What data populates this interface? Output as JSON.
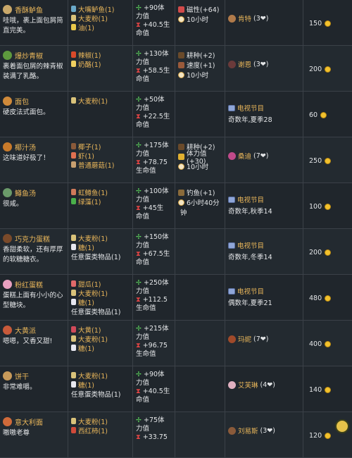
{
  "rows": [
    {
      "name": "香酥鲈鱼",
      "icon_color": "#c9a86a",
      "desc": [
        "哇哦，裹上面包屑简",
        "直完美。"
      ],
      "ingredients": [
        {
          "text": "大嘴鲈鱼(1)",
          "color": "#6aa9c9"
        },
        {
          "text": "大麦粉(1)",
          "color": "#d9c27a"
        },
        {
          "text": "油(1)",
          "color": "#e9c84a"
        }
      ],
      "energy": "+90体",
      "energy2": "力值",
      "health": "+40.5生",
      "health2": "命值",
      "buffs": [
        {
          "text": "磁性(+64)",
          "icon": "magnet-icon",
          "color": "#d24a4a"
        },
        {
          "text": "10小时",
          "icon": "clock-icon"
        }
      ],
      "npc": {
        "name": "肯特",
        "hearts": "(3❤)",
        "face": "#b07a4a"
      },
      "price": "150"
    },
    {
      "name": "爆炒青椒",
      "icon_color": "#5e9a3e",
      "desc": [
        "裹着面包屑的辣青椒",
        "装满了乳酪。"
      ],
      "ingredients": [
        {
          "text": "辣椒(1)",
          "color": "#d94a2a"
        },
        {
          "text": "奶酪(1)",
          "color": "#f0d060"
        }
      ],
      "energy": "+130体",
      "energy2": "力值",
      "health": "+58.5生",
      "health2": "命值",
      "buffs": [
        {
          "text": "耕种(+2)",
          "icon": "hoe-icon",
          "color": "#6a4a2a"
        },
        {
          "text": "速度(+1)",
          "icon": "boots-icon",
          "color": "#9a5a3a"
        },
        {
          "text": "10小时",
          "icon": "clock-icon"
        }
      ],
      "npc": {
        "name": "谢恩",
        "hearts": "(3❤)",
        "face": "#6a3a3a"
      },
      "price": "200"
    },
    {
      "name": "面包",
      "icon_color": "#d08a3a",
      "desc": [
        "硬皮法式面包。"
      ],
      "ingredients": [
        {
          "text": "大麦粉(1)",
          "color": "#d9c27a"
        }
      ],
      "energy": "+50体",
      "energy2": "力值",
      "health": "+22.5生",
      "health2": "命值",
      "buffs": [],
      "tv": {
        "title": "电视节目",
        "sub": "奇数年,夏季28"
      },
      "price": "60"
    },
    {
      "name": "椰汁汤",
      "icon_color": "#c87a2a",
      "desc": [
        "这味道好极了！"
      ],
      "ingredients": [
        {
          "text": "椰子(1)",
          "color": "#8a5a3a"
        },
        {
          "text": "虾(1)",
          "color": "#e07050"
        },
        {
          "text": "普通蘑菇(1)",
          "color": "#c8a070"
        }
      ],
      "energy": "+175体",
      "energy2": "力值",
      "health": "+78.75",
      "health2": "生命值",
      "buffs": [
        {
          "text": "耕种(+2)",
          "icon": "hoe-icon",
          "color": "#6a4a2a"
        },
        {
          "text": "体力值(+30)",
          "icon": "energy-icon",
          "color": "#e0b030"
        },
        {
          "text": "10小时",
          "icon": "clock-icon"
        }
      ],
      "npc": {
        "name": "桑迪",
        "hearts": "(7❤)",
        "face": "#c04a8a"
      },
      "price": "250"
    },
    {
      "name": "鳟鱼汤",
      "icon_color": "#6a9a6a",
      "desc": [
        "很咸。"
      ],
      "ingredients": [
        {
          "text": "虹鳟鱼(1)",
          "color": "#d07a5a"
        },
        {
          "text": "绿藻(1)",
          "color": "#4ab04a"
        }
      ],
      "energy": "+100体",
      "energy2": "力值",
      "health": "+45生",
      "health2": "命值",
      "buffs": [
        {
          "text": "钓鱼(+1)",
          "icon": "rod-icon",
          "color": "#8a6a3a"
        },
        {
          "text": "6小时40分",
          "icon": "clock-icon"
        },
        {
          "text": "钟",
          "icon": ""
        }
      ],
      "tv": {
        "title": "电视节目",
        "sub": "奇数年,秋季14"
      },
      "price": "100"
    },
    {
      "name": "巧克力蛋糕",
      "icon_color": "#7a4a2a",
      "desc": [
        "香甜柔软，还有厚厚",
        "的软糖糖衣。"
      ],
      "ingredients": [
        {
          "text": "大麦粉(1)",
          "color": "#d9c27a"
        },
        {
          "text": "糖(1)",
          "color": "#e8e8f0"
        },
        {
          "text": "任意蛋类物品(1)",
          "color": "",
          "plain": true
        }
      ],
      "energy": "+150体",
      "energy2": "力值",
      "health": "+67.5生",
      "health2": "命值",
      "buffs": [],
      "tv": {
        "title": "电视节目",
        "sub": "奇数年,冬季14"
      },
      "price": "200"
    },
    {
      "name": "粉红蛋糕",
      "icon_color": "#e8a0c0",
      "desc": [
        "蛋糕上面有小小的心",
        "型糖块。"
      ],
      "ingredients": [
        {
          "text": "甜瓜(1)",
          "color": "#e06a6a"
        },
        {
          "text": "大麦粉(1)",
          "color": "#d9c27a"
        },
        {
          "text": "糖(1)",
          "color": "#e8e8f0"
        },
        {
          "text": "任意蛋类物品(1)",
          "color": "",
          "plain": true
        }
      ],
      "energy": "+250体",
      "energy2": "力值",
      "health": "+112.5",
      "health2": "生命值",
      "buffs": [],
      "tv": {
        "title": "电视节目",
        "sub": "偶数年,夏季21"
      },
      "price": "480"
    },
    {
      "name": "大黄派",
      "icon_color": "#c85a3a",
      "desc": [
        "嗯嗯，又香又甜!"
      ],
      "ingredients": [
        {
          "text": "大黄(1)",
          "color": "#d04a5a"
        },
        {
          "text": "大麦粉(1)",
          "color": "#d9c27a"
        },
        {
          "text": "糖(1)",
          "color": "#e8e8f0"
        }
      ],
      "energy": "+215体",
      "energy2": "力值",
      "health": "+96.75",
      "health2": "生命值",
      "buffs": [],
      "npc": {
        "name": "玛妮",
        "hearts": "(7❤)",
        "face": "#a04a2a"
      },
      "price": "400"
    },
    {
      "name": "饼干",
      "icon_color": "#c89a5a",
      "desc": [
        "非常难嚼。"
      ],
      "ingredients": [
        {
          "text": "大麦粉(1)",
          "color": "#d9c27a"
        },
        {
          "text": "糖(1)",
          "color": "#e8e8f0"
        },
        {
          "text": "任意蛋类物品(1)",
          "color": "",
          "plain": true
        }
      ],
      "energy": "+90体",
      "energy2": "力值",
      "health": "+40.5生",
      "health2": "命值",
      "buffs": [],
      "npc": {
        "name": "艾芙琳",
        "hearts": "(4❤)",
        "face": "#e0b0c0"
      },
      "price": "140"
    },
    {
      "name": "意大利面",
      "icon_color": "#d06a3a",
      "desc": [
        "嗷嗷老尊"
      ],
      "ingredients": [
        {
          "text": "大麦粉(1)",
          "color": "#d9c27a"
        },
        {
          "text": "西红柿(1)",
          "color": "#d04a3a"
        }
      ],
      "energy": "+75体",
      "energy2": "力值",
      "health": "+33.75",
      "health2": "",
      "buffs": [],
      "npc": {
        "name": "刘易斯",
        "hearts": "(3❤)",
        "face": "#8a5a3a"
      },
      "price": "120"
    }
  ]
}
